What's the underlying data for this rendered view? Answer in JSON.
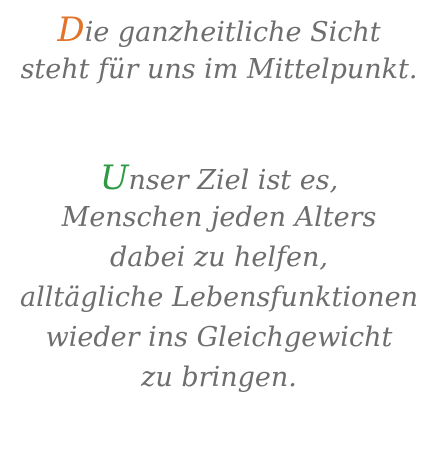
{
  "paragraph1": {
    "initial": "D",
    "line1_rest": "ie ganzheitliche Sicht",
    "line2": "steht für uns im Mittelpunkt."
  },
  "paragraph2": {
    "initial": "U",
    "line1_rest": "nser Ziel ist es,",
    "line2": "Menschen jeden Alters",
    "line3": "dabei zu helfen,",
    "line4": "alltägliche Lebensfunktionen",
    "line5": "wieder ins Gleichgewicht",
    "line6": "zu bringen."
  },
  "colors": {
    "text": "#6e6e6e",
    "initial_d": "#e2732a",
    "initial_u": "#2e9a45",
    "background": "#ffffff"
  }
}
